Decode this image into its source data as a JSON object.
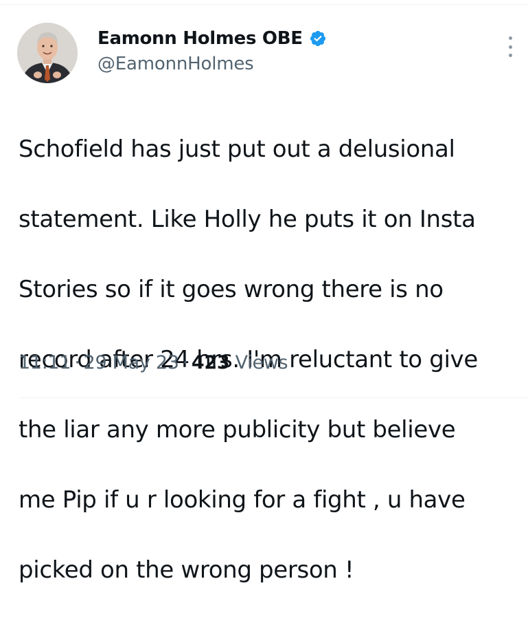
{
  "tweet": {
    "author": {
      "display_name": "Eamonn Holmes OBE",
      "handle": "@EamonnHolmes",
      "verified": true,
      "avatar_icon": "profile-photo"
    },
    "text_lines": [
      "Schofield has just put out a delusional",
      "statement. Like Holly he puts it on Insta",
      "Stories so if it goes wrong there is no",
      "record after 24 hrs. I'm reluctant to give",
      "the liar any more publicity but believe",
      "me Pip if u r looking for a fight , u have",
      "picked on the wrong person !"
    ],
    "meta": {
      "time": "11:11",
      "separator": "·",
      "date": "29 May 23",
      "views_count": "423",
      "views_label": "Views"
    },
    "more_icon": "more-vertical-icon"
  },
  "colors": {
    "verified_badge": "#1d9bf0",
    "text_primary": "#0f1419",
    "text_secondary": "#536471",
    "divider": "#eff3f4"
  }
}
